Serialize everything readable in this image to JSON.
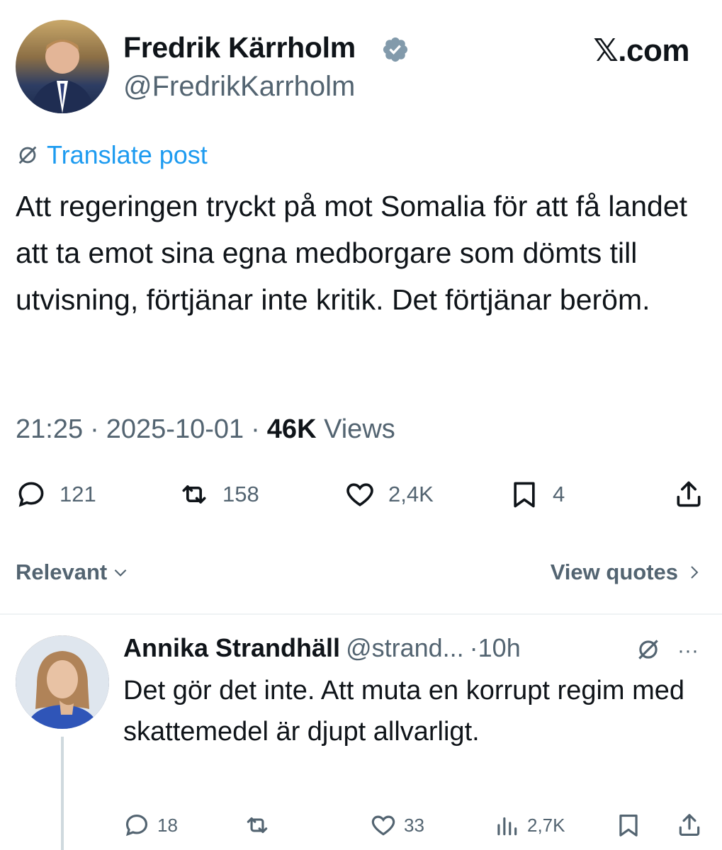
{
  "header": {
    "author_name": "Fredrik Kärrholm",
    "author_handle": "@FredrikKarrholm",
    "brand": "𝕏.com"
  },
  "post": {
    "translate_label": "Translate post",
    "text": "Att regeringen tryckt på mot Somalia för att få landet att ta emot sina egna medborgare som dömts till utvisning, förtjänar inte kritik. Det förtjänar beröm.",
    "time": "21:25",
    "date": "2025-10-01",
    "views_count": "46K",
    "views_label": "Views",
    "separator": "·"
  },
  "actions": {
    "replies": "121",
    "reposts": "158",
    "likes": "2,4K",
    "bookmarks": "4"
  },
  "filter": {
    "sort_label": "Relevant",
    "view_quotes_label": "View quotes"
  },
  "reply": {
    "name": "Annika Strandhäll",
    "handle": "@strand...",
    "time": "·10h",
    "more": "···",
    "text": "Det gör det inte. Att muta en korrupt regim med skattemedel är djupt allvarligt.",
    "replies": "18",
    "likes": "33",
    "views": "2,7K"
  },
  "colors": {
    "accent": "#1d9bf0",
    "muted": "#536471",
    "text": "#0f1419",
    "verified": "#829aab"
  }
}
